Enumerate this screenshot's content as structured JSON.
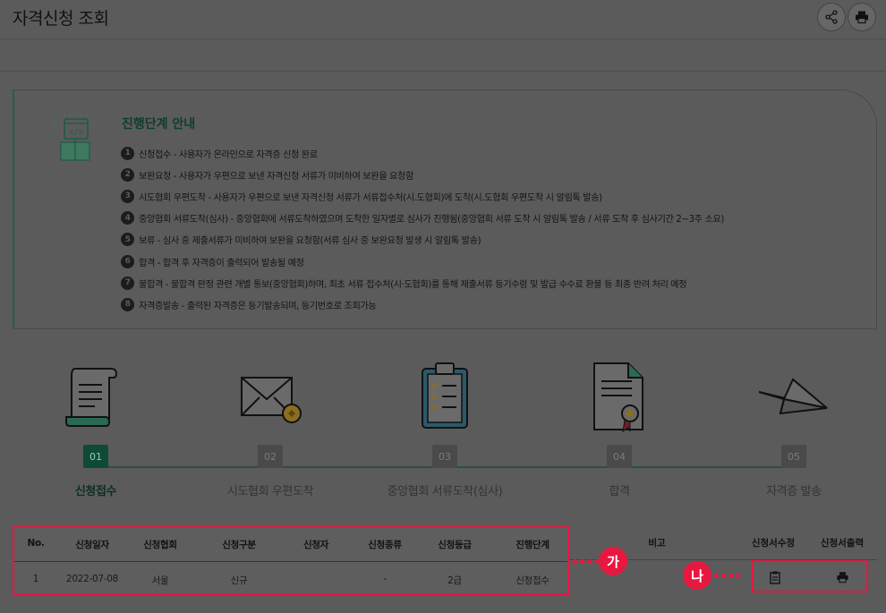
{
  "page": {
    "title": "자격신청 조회"
  },
  "guide": {
    "title": "진행단계 안내",
    "steps": [
      {
        "num": "1",
        "text": "신청접수 - 사용자가 온라인으로 자격증 신청 완료"
      },
      {
        "num": "2",
        "text": "보완요청 - 사용자가 우편으로 보낸 자격신청 서류가 미비하여 보완을 요청함"
      },
      {
        "num": "3",
        "text": "시도협회 우편도착 - 사용자가 우편으로 보낸 자격신청 서류가 서류접수처(시.도협회)에 도착(시.도협회 우편도착 시 알림톡 발송)"
      },
      {
        "num": "4",
        "text": "중앙협회 서류도착(심사) - 중앙협회에 서류도착하였으며 도착한 일자별로 심사가 진행됨(중앙협회 서류 도착 시 알림톡 발송 / 서류 도착 후 심사기간 2~3주 소요)"
      },
      {
        "num": "5",
        "text": "보류 - 심사 중 제출서류가 미비하여 보완을 요청함(서류 심사 중 보완요청 발생 시 알림톡 발송)"
      },
      {
        "num": "6",
        "text": "합격 - 합격 후 자격증이 출력되어 발송될 예정"
      },
      {
        "num": "7",
        "text": "불합격 - 불합격 판정 관련 개별 통보(중앙협회)하며, 최초 서류 접수처(시·도협회)를 통해 제출서류 등기수령 및 발급 수수료 환불 등 최종 반려 처리 예정"
      },
      {
        "num": "8",
        "text": "자격증발송 - 출력된 자격증은 등기발송되며, 등기번호로 조회가능"
      }
    ]
  },
  "process": [
    {
      "num": "01",
      "label": "신청접수",
      "active": true
    },
    {
      "num": "02",
      "label": "시도협회 우편도착",
      "active": false
    },
    {
      "num": "03",
      "label": "중앙협회 서류도착(심사)",
      "active": false
    },
    {
      "num": "04",
      "label": "합격",
      "active": false
    },
    {
      "num": "05",
      "label": "자격증 발송",
      "active": false
    }
  ],
  "table": {
    "headers": [
      "No.",
      "신청일자",
      "신청협회",
      "신청구분",
      "신청자",
      "신청종류",
      "신청등급",
      "진행단계",
      "비고",
      "신청서수정",
      "신청서출력"
    ],
    "rows": [
      [
        "1",
        "2022-07-08",
        "서울",
        "신규",
        "",
        "-",
        "2급",
        "신청접수",
        "",
        "",
        ""
      ]
    ]
  },
  "callouts": {
    "a": "가",
    "b": "나"
  },
  "colors": {
    "accent": "#e8173f",
    "active_step": "#0e4a35"
  },
  "icons": {
    "share": "share-icon",
    "print": "print-icon",
    "edit": "clipboard-icon"
  }
}
